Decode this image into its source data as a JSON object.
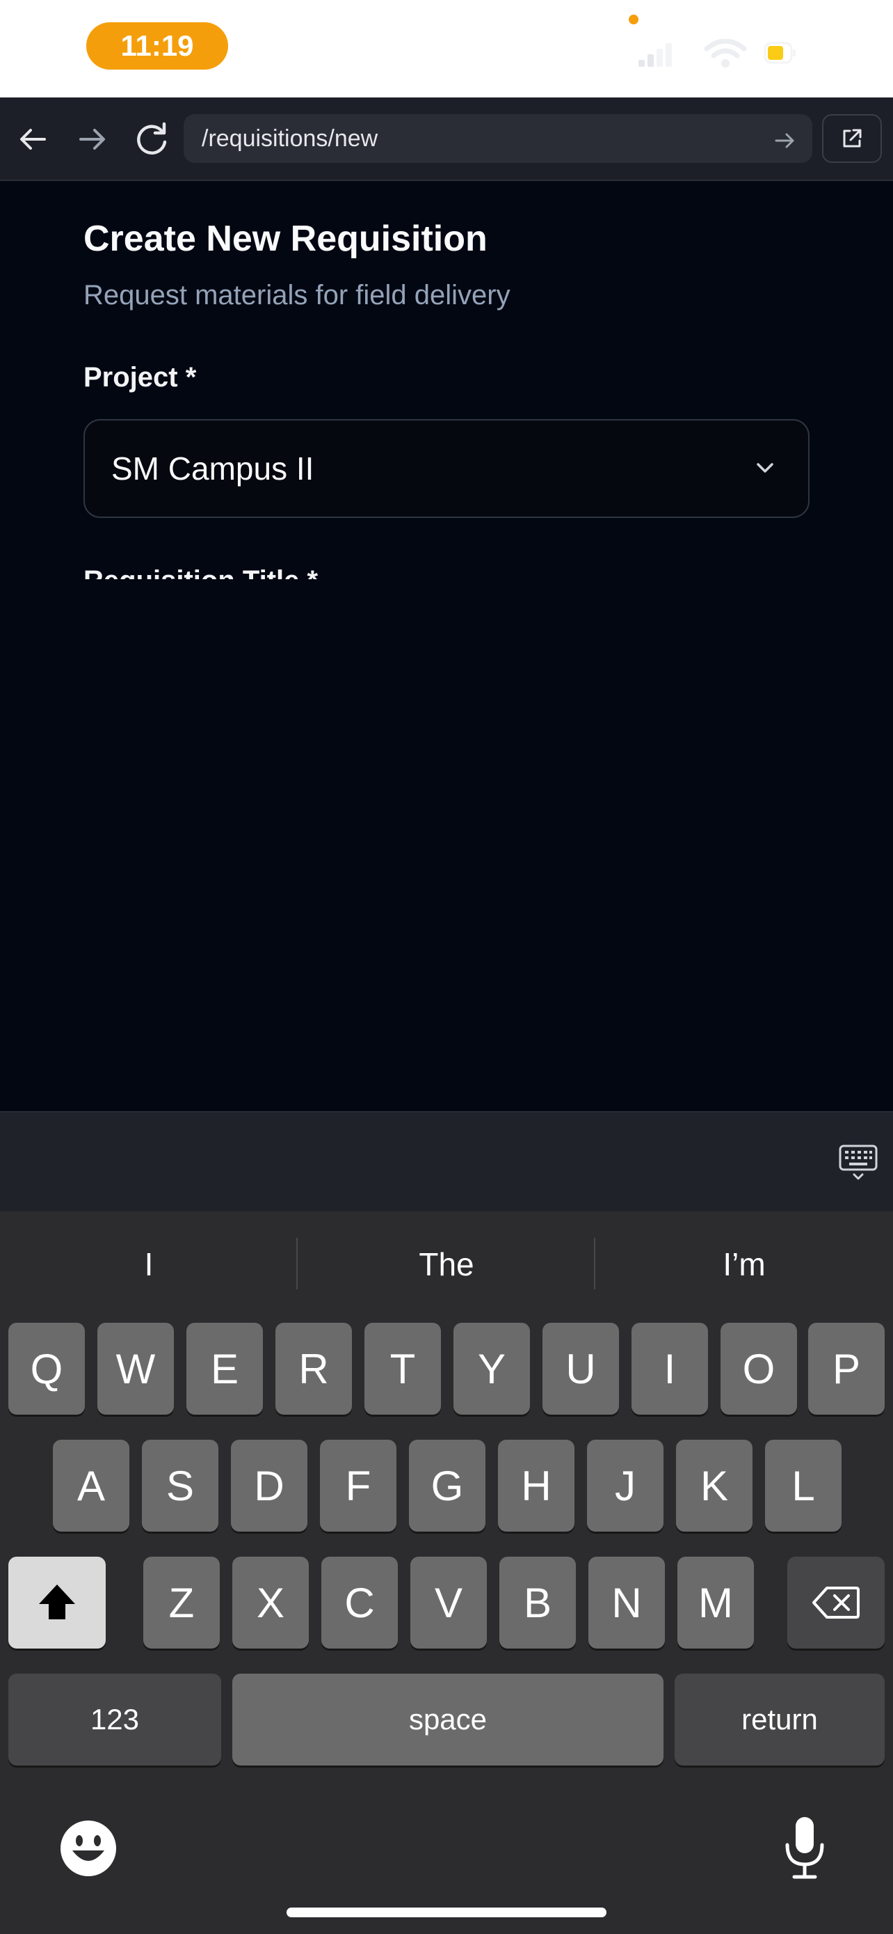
{
  "status_bar": {
    "time": "11:19",
    "icons": [
      "cellular-signal-icon",
      "wifi-icon",
      "battery-low-power-icon"
    ],
    "accent_color": "#f59e0b"
  },
  "browser": {
    "url": "/requisitions/new",
    "icons": [
      "back-arrow-icon",
      "forward-arrow-icon",
      "reload-icon",
      "go-arrow-icon",
      "open-external-icon"
    ]
  },
  "page": {
    "title": "Create New Requisition",
    "subtitle": "Request materials for field delivery",
    "project_label": "Project *",
    "project_value": "SM Campus II",
    "title_field_label": "Requisition Title *"
  },
  "keyboard": {
    "suggestions": [
      "I",
      "The",
      "I’m"
    ],
    "row1": [
      "Q",
      "W",
      "E",
      "R",
      "T",
      "Y",
      "U",
      "I",
      "O",
      "P"
    ],
    "row2": [
      "A",
      "S",
      "D",
      "F",
      "G",
      "H",
      "J",
      "K",
      "L"
    ],
    "row3": [
      "Z",
      "X",
      "C",
      "V",
      "B",
      "N",
      "M"
    ],
    "numbers_label": "123",
    "space_label": "space",
    "return_label": "return"
  }
}
